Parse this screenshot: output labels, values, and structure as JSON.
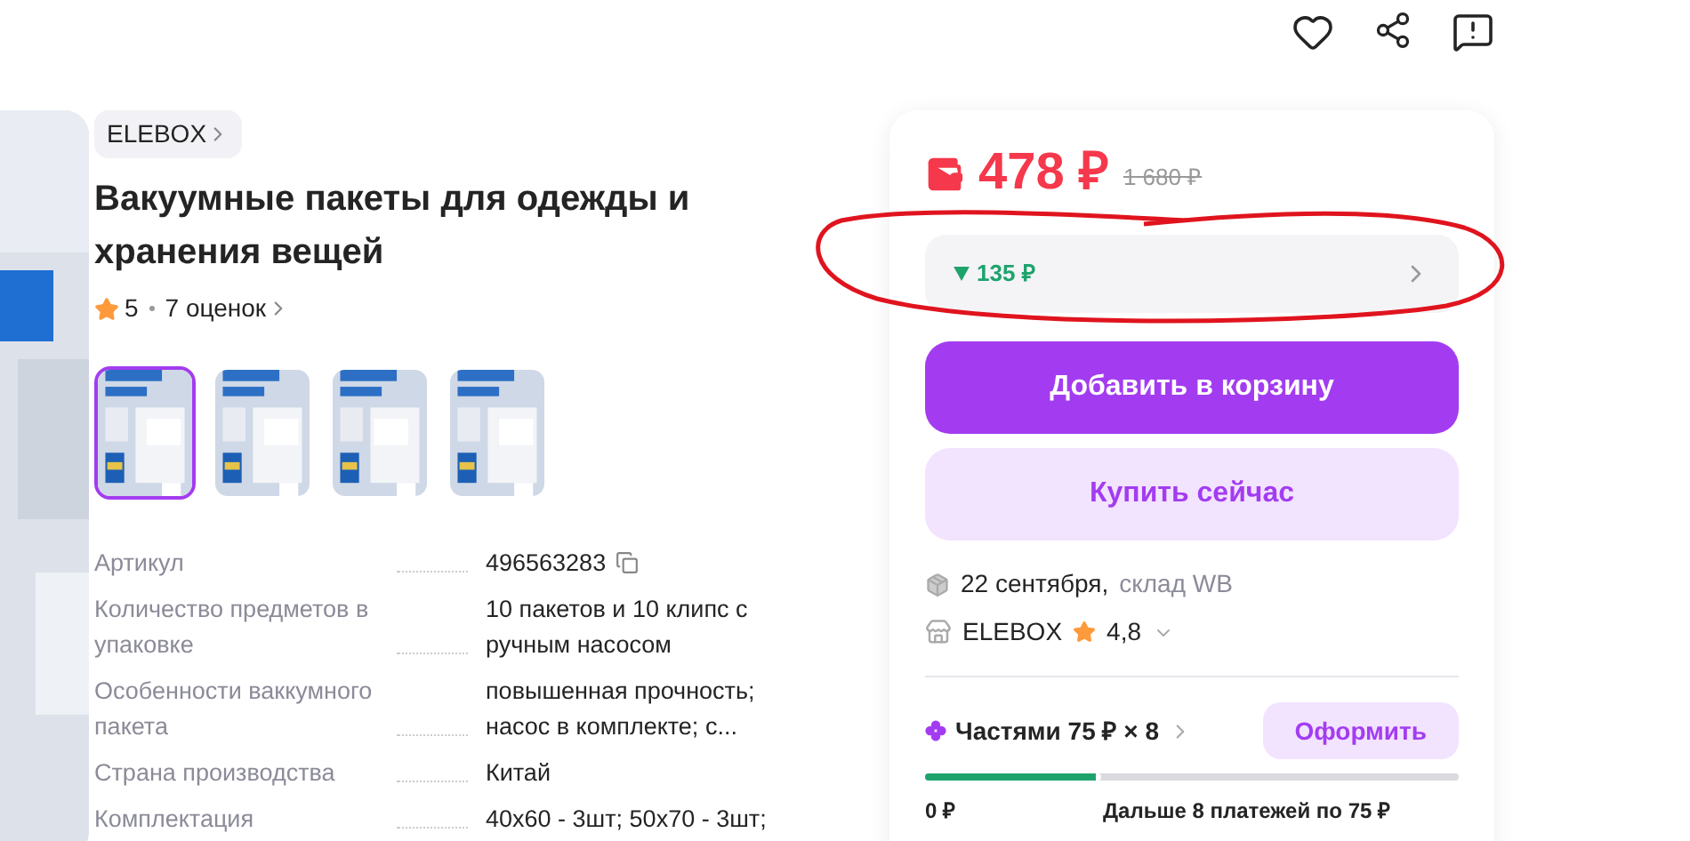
{
  "brand": {
    "label": "ELEBOX"
  },
  "title": "Вакуумные пакеты для одежды и хранения вещей",
  "rating": {
    "value": "5",
    "reviews": "7 оценок"
  },
  "thumbnails": [
    {
      "kind": "picture",
      "selected": true
    },
    {
      "kind": "picture",
      "selected": false
    },
    {
      "kind": "picture",
      "selected": false
    },
    {
      "kind": "picture",
      "selected": false
    }
  ],
  "specs": [
    {
      "label": "Артикул",
      "value": "496563283",
      "copy": true
    },
    {
      "label": "Количество предметов в упаковке",
      "value": "10 пакетов и 10 клипс с ручным насосом",
      "copy": false
    },
    {
      "label": "Особенности ваккумного пакета",
      "value": "повышенная прочность; насос в комплекте; с...",
      "copy": false
    },
    {
      "label": "Страна производства",
      "value": "Китай",
      "copy": false
    },
    {
      "label": "Комплектация",
      "value": "40х60 - 3шт; 50х70 - 3шт;",
      "copy": false
    }
  ],
  "price": {
    "current": "478 ₽",
    "old": "1 680 ₽",
    "discount": "135 ₽"
  },
  "buttons": {
    "cart": "Добавить в корзину",
    "buy": "Купить сейчас"
  },
  "delivery": {
    "date": "22 сентября,",
    "warehouse": "склад WB"
  },
  "seller": {
    "name": "ELEBOX",
    "rating": "4,8"
  },
  "installments": {
    "label": "Частями 75 ₽ × 8",
    "action": "Оформить",
    "level": 0.33,
    "now": "0 ₽",
    "later": "Дальше 8 платежей по 75 ₽"
  },
  "annotation": {
    "kind": "ellipse"
  }
}
